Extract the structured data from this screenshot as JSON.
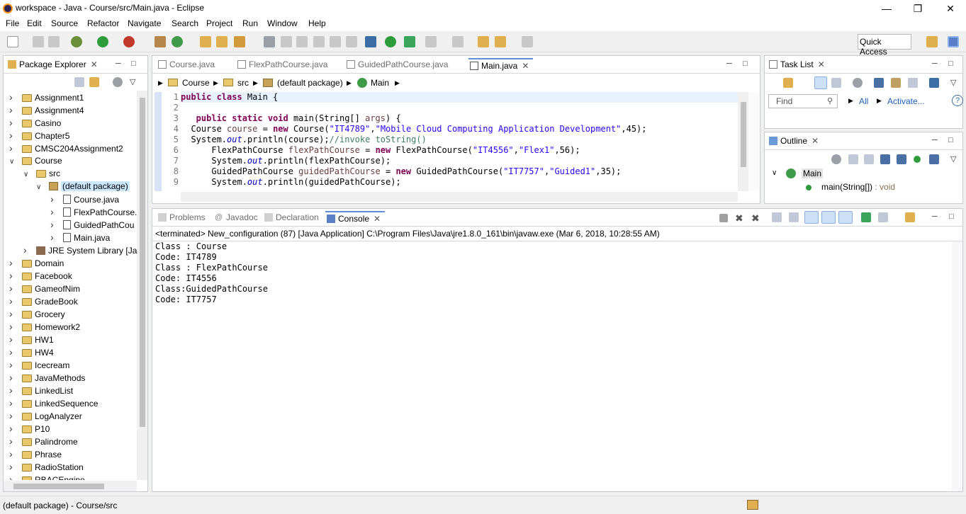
{
  "window": {
    "title": "workspace - Java - Course/src/Main.java - Eclipse"
  },
  "menu": [
    "File",
    "Edit",
    "Source",
    "Refactor",
    "Navigate",
    "Search",
    "Project",
    "Run",
    "Window",
    "Help"
  ],
  "quick_access": "Quick Access",
  "package_explorer": {
    "title": "Package Explorer",
    "items": [
      {
        "label": "Assignment1"
      },
      {
        "label": "Assignment4"
      },
      {
        "label": "Casino"
      },
      {
        "label": "Chapter5"
      },
      {
        "label": "CMSC204Assignment2"
      },
      {
        "label": "Course"
      },
      {
        "label": "src"
      },
      {
        "label": "(default package)"
      },
      {
        "label": "Course.java"
      },
      {
        "label": "FlexPathCourse."
      },
      {
        "label": "GuidedPathCou"
      },
      {
        "label": "Main.java"
      },
      {
        "label": "JRE System Library [Java"
      },
      {
        "label": "Domain"
      },
      {
        "label": "Facebook"
      },
      {
        "label": "GameofNim"
      },
      {
        "label": "GradeBook"
      },
      {
        "label": "Grocery"
      },
      {
        "label": "Homework2"
      },
      {
        "label": "HW1"
      },
      {
        "label": "HW4"
      },
      {
        "label": "Icecream"
      },
      {
        "label": "JavaMethods"
      },
      {
        "label": "LinkedList"
      },
      {
        "label": "LinkedSequence"
      },
      {
        "label": "LogAnalyzer"
      },
      {
        "label": "P10"
      },
      {
        "label": "Palindrome"
      },
      {
        "label": "Phrase"
      },
      {
        "label": "RadioStation"
      },
      {
        "label": "RBACEngine"
      }
    ]
  },
  "editor": {
    "tabs": [
      "Course.java",
      "FlexPathCourse.java",
      "GuidedPathCourse.java",
      "Main.java"
    ],
    "breadcrumb": [
      "Course",
      "src",
      "(default package)",
      "Main"
    ],
    "line_numbers": [
      "1",
      "2",
      "3",
      "4",
      "5",
      "6",
      "7",
      "8",
      "9"
    ],
    "lines": [
      {
        "a": "public class",
        "b": " Main {"
      },
      {
        "a": "",
        "b": ""
      },
      {
        "a": "   public static void",
        "b": " main(String[] ",
        "c": "args",
        "d": ") {"
      },
      {
        "a": "  Course ",
        "b": "course",
        "c": " = ",
        "d": "new",
        "e": " Course(",
        "f": "\"IT4789\"",
        "g": ",",
        "h": "\"Mobile Cloud Computing Application Development\"",
        "i": ",45);"
      },
      {
        "a": "  System.",
        "b": "out",
        "c": ".println(course);",
        "d": "//invoke toString()"
      },
      {
        "a": "      FlexPathCourse ",
        "b": "flexPathCourse",
        "c": " = ",
        "d": "new",
        "e": " FlexPathCourse(",
        "f": "\"IT4556\"",
        "g": ",",
        "h": "\"Flex1\"",
        "i": ",56);"
      },
      {
        "a": "      System.",
        "b": "out",
        "c": ".println(flexPathCourse);"
      },
      {
        "a": "      GuidedPathCourse ",
        "b": "guidedPathCourse",
        "c": " = ",
        "d": "new",
        "e": " GuidedPathCourse(",
        "f": "\"IT7757\"",
        "g": ",",
        "h": "\"Guided1\"",
        "i": ",35);"
      },
      {
        "a": "      System.",
        "b": "out",
        "c": ".println(guidedPathCourse);"
      }
    ]
  },
  "task_list": {
    "title": "Task List",
    "find_placeholder": "Find",
    "all": "All",
    "activate": "Activate..."
  },
  "outline": {
    "title": "Outline",
    "class": "Main",
    "method": "main(String[])",
    "method_type": " : void"
  },
  "bottom": {
    "tabs": [
      "Problems",
      "Javadoc",
      "Declaration",
      "Console"
    ],
    "status": "<terminated> New_configuration (87) [Java Application] C:\\Program Files\\Java\\jre1.8.0_161\\bin\\javaw.exe (Mar 6, 2018, 10:28:55 AM)",
    "output": [
      "Class : Course",
      "Code: IT4789",
      "Class : FlexPathCourse",
      "Code: IT4556",
      "Class:GuidedPathCourse",
      "Code: IT7757"
    ]
  },
  "statusbar": {
    "text": "(default package) - Course/src"
  }
}
